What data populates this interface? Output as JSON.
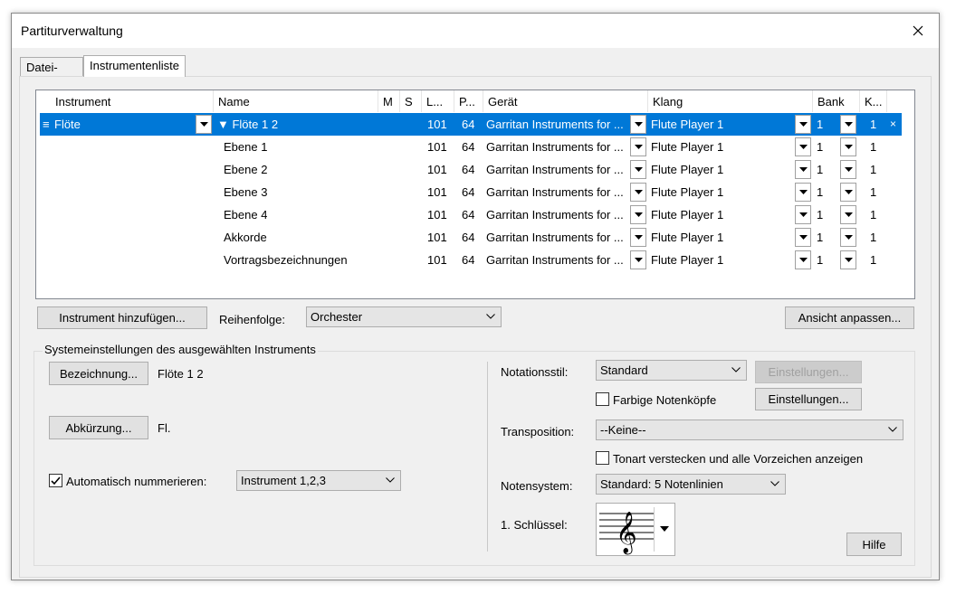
{
  "window": {
    "title": "Partiturverwaltung"
  },
  "tabs": [
    {
      "label": "Datei-Info"
    },
    {
      "label": "Instrumentenliste"
    }
  ],
  "grid": {
    "headers": [
      "Instrument",
      "Name",
      "M",
      "S",
      "L...",
      "P...",
      "Gerät",
      "Klang",
      "Bank",
      "K..."
    ],
    "selected_row": {
      "handle": "≡",
      "instrument": "Flöte",
      "name": "▼ Flöte 1 2",
      "l": "101",
      "p": "64",
      "device": "Garritan Instruments for ...",
      "sound": "Flute Player 1",
      "bank": "1",
      "k": "1",
      "remove": "×"
    },
    "rows": [
      {
        "name": "Ebene 1",
        "l": "101",
        "p": "64",
        "device": "Garritan Instruments for ...",
        "sound": "Flute Player 1",
        "bank": "1",
        "k": "1"
      },
      {
        "name": "Ebene 2",
        "l": "101",
        "p": "64",
        "device": "Garritan Instruments for ...",
        "sound": "Flute Player 1",
        "bank": "1",
        "k": "1"
      },
      {
        "name": "Ebene 3",
        "l": "101",
        "p": "64",
        "device": "Garritan Instruments for ...",
        "sound": "Flute Player 1",
        "bank": "1",
        "k": "1"
      },
      {
        "name": "Ebene 4",
        "l": "101",
        "p": "64",
        "device": "Garritan Instruments for ...",
        "sound": "Flute Player 1",
        "bank": "1",
        "k": "1"
      },
      {
        "name": "Akkorde",
        "l": "101",
        "p": "64",
        "device": "Garritan Instruments for ...",
        "sound": "Flute Player 1",
        "bank": "1",
        "k": "1"
      },
      {
        "name": "Vortragsbezeichnungen",
        "l": "101",
        "p": "64",
        "device": "Garritan Instruments for ...",
        "sound": "Flute Player 1",
        "bank": "1",
        "k": "1"
      }
    ]
  },
  "controls": {
    "add_instrument": "Instrument hinzufügen...",
    "order_label": "Reihenfolge:",
    "order_value": "Orchester",
    "customize_view": "Ansicht anpassen..."
  },
  "group": {
    "title": "Systemeinstellungen des ausgewählten Instruments",
    "designation_btn": "Bezeichnung...",
    "designation_value": "Flöte 1 2",
    "abbrev_btn": "Abkürzung...",
    "abbrev_value": "Fl.",
    "auto_number_label": "Automatisch nummerieren:",
    "auto_number_value": "Instrument 1,2,3",
    "notation_style_label": "Notationsstil:",
    "notation_style_value": "Standard",
    "settings_disabled": "Einstellungen...",
    "colored_noteheads_label": "Farbige Notenköpfe",
    "settings_btn": "Einstellungen...",
    "transposition_label": "Transposition:",
    "transposition_value": "--Keine--",
    "hide_key_label": "Tonart verstecken und alle Vorzeichen anzeigen",
    "staff_label": "Notensystem:",
    "staff_value": "Standard: 5 Notenlinien",
    "clef_label": "1. Schlüssel:",
    "help_btn": "Hilfe"
  },
  "colors": {
    "selection": "#0078d7",
    "dialog_bg": "#f0f0f0"
  }
}
